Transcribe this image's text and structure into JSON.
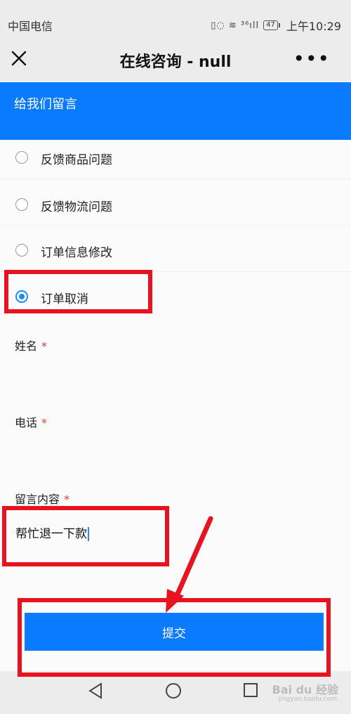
{
  "status_bar": {
    "carrier": "中国电信",
    "signal_icons": "▯◌ ≋ ³⁶ıll",
    "battery": "47",
    "time": "上午10:29"
  },
  "title_bar": {
    "title": "在线咨询 - null",
    "more": "•••"
  },
  "header": {
    "text": "给我们留言"
  },
  "options": [
    {
      "label": "反馈商品问题",
      "checked": false
    },
    {
      "label": "反馈物流问题",
      "checked": false
    },
    {
      "label": "订单信息修改",
      "checked": false
    },
    {
      "label": "订单取消",
      "checked": true
    }
  ],
  "fields": {
    "name_label": "姓名",
    "phone_label": "电话",
    "message_label": "留言内容",
    "required_mark": "*",
    "name_value": "",
    "phone_value": "",
    "message_value": "帮忙退一下款"
  },
  "submit_label": "提交",
  "watermark": {
    "main": "Bai du 经验",
    "sub": "jingyan.baidu.com"
  },
  "colors": {
    "accent": "#0a7bff",
    "radio_checked": "#1a8cff",
    "required": "#e53935",
    "annotation": "#e8131f"
  }
}
